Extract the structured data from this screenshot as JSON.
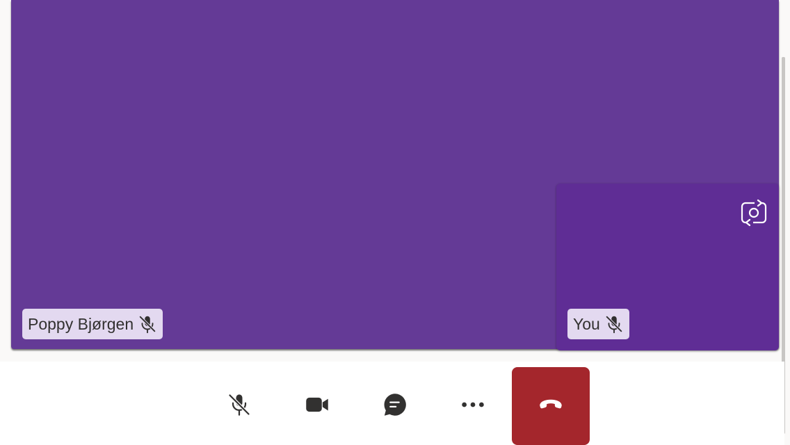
{
  "call": {
    "remote_participant": {
      "name": "Poppy Bjørgen",
      "muted": true,
      "tile_color": "#643a96"
    },
    "self_view": {
      "name": "You",
      "muted": true,
      "tile_color": "#5f2d95",
      "switch_camera_icon": "camera-switch-icon"
    }
  },
  "controls": [
    {
      "id": "microphone",
      "icon": "microphone-off-icon",
      "state": "muted"
    },
    {
      "id": "camera",
      "icon": "video-camera-icon",
      "state": "on"
    },
    {
      "id": "chat",
      "icon": "chat-icon"
    },
    {
      "id": "more",
      "icon": "more-options-icon"
    },
    {
      "id": "hang-up",
      "icon": "phone-hangup-icon",
      "color": "#a4262c"
    }
  ],
  "colors": {
    "stage": "#643a96",
    "name_tag_bg": "#e3d9f0",
    "hangup": "#a4262c",
    "icon": "#323130"
  }
}
